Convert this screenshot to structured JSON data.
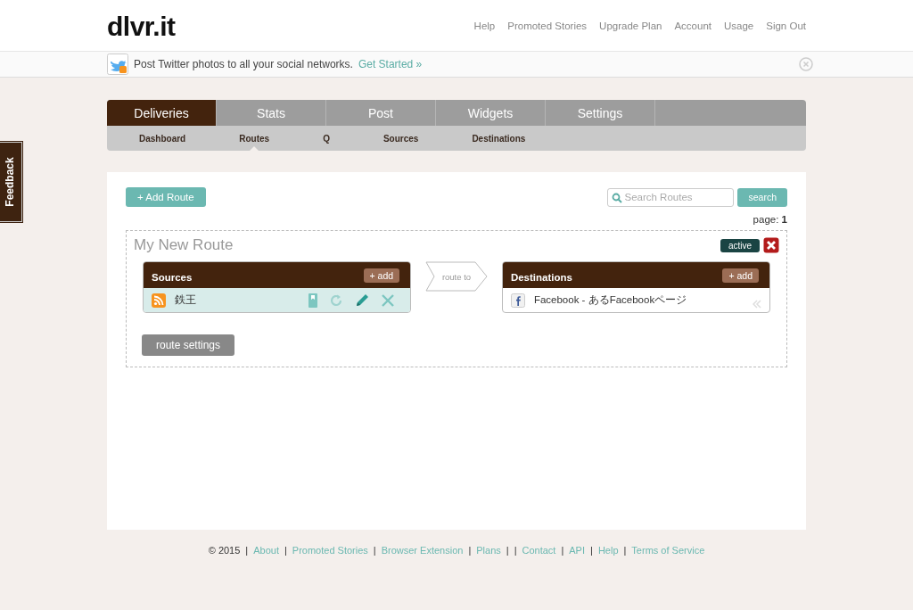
{
  "logo": "dlvr.it",
  "top_nav": [
    "Help",
    "Promoted Stories",
    "Upgrade Plan",
    "Account",
    "Usage",
    "Sign Out"
  ],
  "banner": {
    "text": "Post Twitter photos to all your social networks.",
    "link": "Get Started »"
  },
  "feedback": "Feedback",
  "tabs": [
    {
      "label": "Deliveries",
      "selected": true
    },
    {
      "label": "Stats",
      "selected": false
    },
    {
      "label": "Post",
      "selected": false
    },
    {
      "label": "Widgets",
      "selected": false
    },
    {
      "label": "Settings",
      "selected": false
    }
  ],
  "subtabs": [
    {
      "label": "Dashboard",
      "selected": false
    },
    {
      "label": "Routes",
      "selected": true
    },
    {
      "label": "Q",
      "selected": false
    },
    {
      "label": "Sources",
      "selected": false
    },
    {
      "label": "Destinations",
      "selected": false
    }
  ],
  "add_route": "+ Add Route",
  "search": {
    "placeholder": "Search Routes",
    "button": "search"
  },
  "page": {
    "label": "page:",
    "number": "1"
  },
  "route": {
    "title": "My New Route",
    "status": "active",
    "active": true,
    "sources": {
      "title": "Sources",
      "add": "+ add",
      "items": [
        {
          "name": "鉄王",
          "kind": "rss"
        }
      ]
    },
    "connector": "route to",
    "destinations": {
      "title": "Destinations",
      "add": "+ add",
      "items": [
        {
          "name": "Facebook - あるFacebookページ",
          "kind": "facebook"
        }
      ]
    },
    "settings": "route settings"
  },
  "footer": [
    {
      "kind": "text",
      "text": "© 2015"
    },
    {
      "kind": "sep",
      "text": "|"
    },
    {
      "kind": "link",
      "text": "About"
    },
    {
      "kind": "sep",
      "text": "|"
    },
    {
      "kind": "link",
      "text": "Promoted Stories"
    },
    {
      "kind": "sep",
      "text": "|"
    },
    {
      "kind": "link",
      "text": "Browser Extension"
    },
    {
      "kind": "sep",
      "text": "|"
    },
    {
      "kind": "link",
      "text": "Plans"
    },
    {
      "kind": "sep",
      "text": "|"
    },
    {
      "kind": "sep",
      "text": "|"
    },
    {
      "kind": "link",
      "text": "Contact"
    },
    {
      "kind": "sep",
      "text": "|"
    },
    {
      "kind": "link",
      "text": "API"
    },
    {
      "kind": "sep",
      "text": "|"
    },
    {
      "kind": "link",
      "text": "Help"
    },
    {
      "kind": "sep",
      "text": "|"
    },
    {
      "kind": "link",
      "text": "Terms of Service"
    }
  ]
}
